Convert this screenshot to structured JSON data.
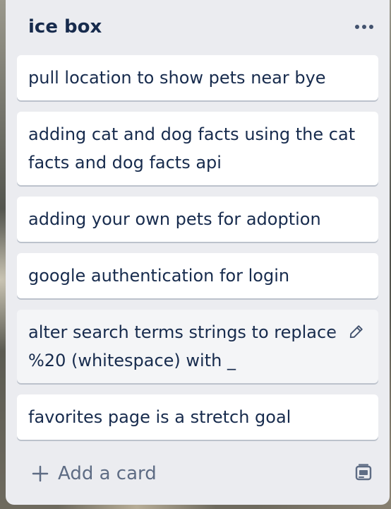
{
  "list": {
    "title": "ice box",
    "menu_icon": "more-horizontal-icon",
    "cards": [
      {
        "text": "pull location to show pets near bye"
      },
      {
        "text": "adding cat and dog facts using the cat facts and dog facts api"
      },
      {
        "text": "adding your own pets for adoption"
      },
      {
        "text": "google authentication for login"
      },
      {
        "text": "alter search terms strings to replace %20 (whitespace) with _",
        "edit_icon": "pencil-icon"
      },
      {
        "text": "favorites page is a stretch goal"
      }
    ],
    "footer": {
      "add_card_label": "Add a card",
      "add_icon": "plus-icon",
      "template_icon": "card-template-icon"
    }
  },
  "colors": {
    "list_background": "#ebecf0",
    "card_background": "#ffffff",
    "text_primary": "#172b4d",
    "text_secondary": "#5e6c84"
  }
}
